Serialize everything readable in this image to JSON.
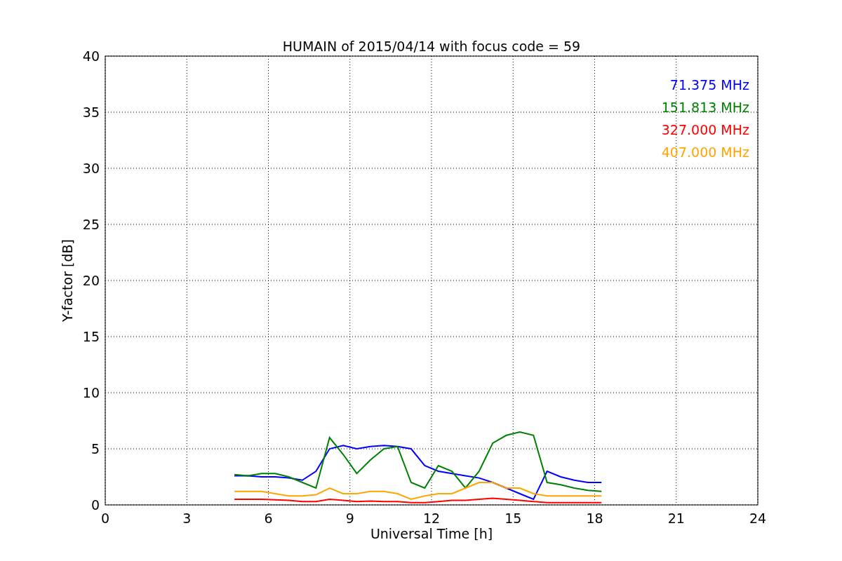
{
  "figure": {
    "chart_data": {
      "type": "line",
      "title": "HUMAIN of 2015/04/14 with focus code = 59",
      "xlabel": "Universal Time [h]",
      "ylabel": "Y-factor [dB]",
      "x": [
        4.75,
        5.25,
        5.75,
        6.25,
        6.75,
        7.25,
        7.75,
        8.25,
        8.75,
        9.25,
        9.75,
        10.25,
        10.75,
        11.25,
        11.75,
        12.25,
        12.75,
        13.25,
        13.75,
        14.25,
        14.75,
        15.25,
        15.75,
        16.25,
        16.75,
        17.25,
        17.75,
        18.25
      ],
      "series": [
        {
          "name": "71.375 MHz",
          "color": "#0000ff",
          "values": [
            2.6,
            2.6,
            2.5,
            2.5,
            2.4,
            2.2,
            3.0,
            5.0,
            5.3,
            5.0,
            5.2,
            5.3,
            5.2,
            5.0,
            3.5,
            3.0,
            2.8,
            2.6,
            2.4,
            2.0,
            1.5,
            1.0,
            0.5,
            3.0,
            2.5,
            2.2,
            2.0,
            2.0
          ]
        },
        {
          "name": "151.813 MHz",
          "color": "#008000",
          "values": [
            2.7,
            2.6,
            2.8,
            2.8,
            2.5,
            2.0,
            1.5,
            6.0,
            4.5,
            2.8,
            4.0,
            5.0,
            5.2,
            2.0,
            1.5,
            3.5,
            3.0,
            1.5,
            3.0,
            5.5,
            6.2,
            6.5,
            6.2,
            2.0,
            1.8,
            1.5,
            1.3,
            1.2
          ]
        },
        {
          "name": "327.000 MHz",
          "color": "#ff0000",
          "values": [
            0.5,
            0.5,
            0.5,
            0.45,
            0.4,
            0.3,
            0.3,
            0.5,
            0.4,
            0.3,
            0.35,
            0.3,
            0.3,
            0.2,
            0.2,
            0.3,
            0.4,
            0.4,
            0.5,
            0.6,
            0.5,
            0.4,
            0.3,
            0.2,
            0.2,
            0.2,
            0.2,
            0.2
          ]
        },
        {
          "name": "407.000 MHz",
          "color": "#ffa500",
          "values": [
            1.2,
            1.2,
            1.2,
            1.0,
            0.8,
            0.8,
            0.9,
            1.5,
            1.0,
            1.0,
            1.2,
            1.2,
            1.0,
            0.5,
            0.8,
            1.0,
            1.0,
            1.5,
            2.0,
            2.0,
            1.5,
            1.5,
            1.0,
            0.8,
            0.8,
            0.8,
            0.8,
            0.8
          ]
        }
      ],
      "grid": true,
      "xlim": [
        0,
        24
      ],
      "ylim": [
        0,
        40
      ],
      "xticks": [
        0,
        3,
        6,
        9,
        12,
        15,
        18,
        21,
        24
      ],
      "yticks": [
        0,
        5,
        10,
        15,
        20,
        25,
        30,
        35,
        40
      ]
    }
  }
}
